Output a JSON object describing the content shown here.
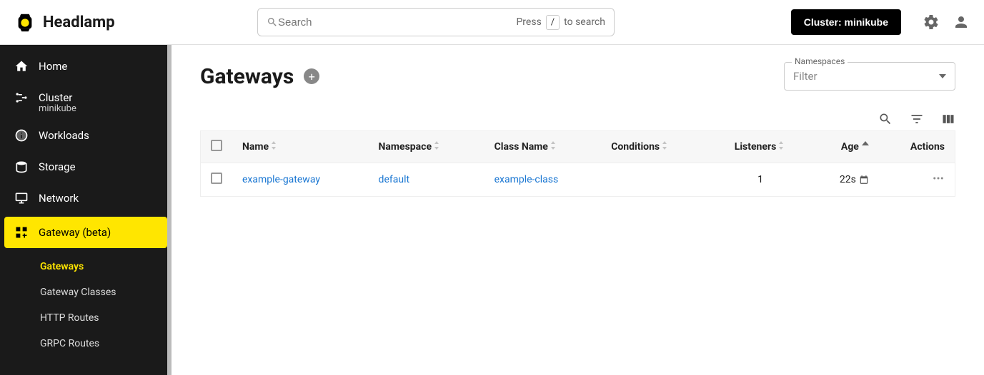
{
  "app": {
    "name": "Headlamp"
  },
  "search": {
    "placeholder": "Search",
    "hint_pre": "Press",
    "hint_key": "/",
    "hint_post": "to search"
  },
  "cluster_button": "Cluster: minikube",
  "sidebar": {
    "items": [
      {
        "label": "Home"
      },
      {
        "label": "Cluster",
        "sub": "minikube"
      },
      {
        "label": "Workloads"
      },
      {
        "label": "Storage"
      },
      {
        "label": "Network"
      },
      {
        "label": "Gateway (beta)",
        "active": true
      }
    ],
    "subnav": [
      {
        "label": "Gateways",
        "active": true
      },
      {
        "label": "Gateway Classes"
      },
      {
        "label": "HTTP Routes"
      },
      {
        "label": "GRPC Routes"
      }
    ]
  },
  "page": {
    "title": "Gateways"
  },
  "ns_filter": {
    "label": "Namespaces",
    "placeholder": "Filter"
  },
  "table": {
    "headers": {
      "name": "Name",
      "namespace": "Namespace",
      "class": "Class Name",
      "conditions": "Conditions",
      "listeners": "Listeners",
      "age": "Age",
      "actions": "Actions"
    },
    "rows": [
      {
        "name": "example-gateway",
        "namespace": "default",
        "class": "example-class",
        "conditions": "",
        "listeners": "1",
        "age": "22s"
      }
    ]
  }
}
